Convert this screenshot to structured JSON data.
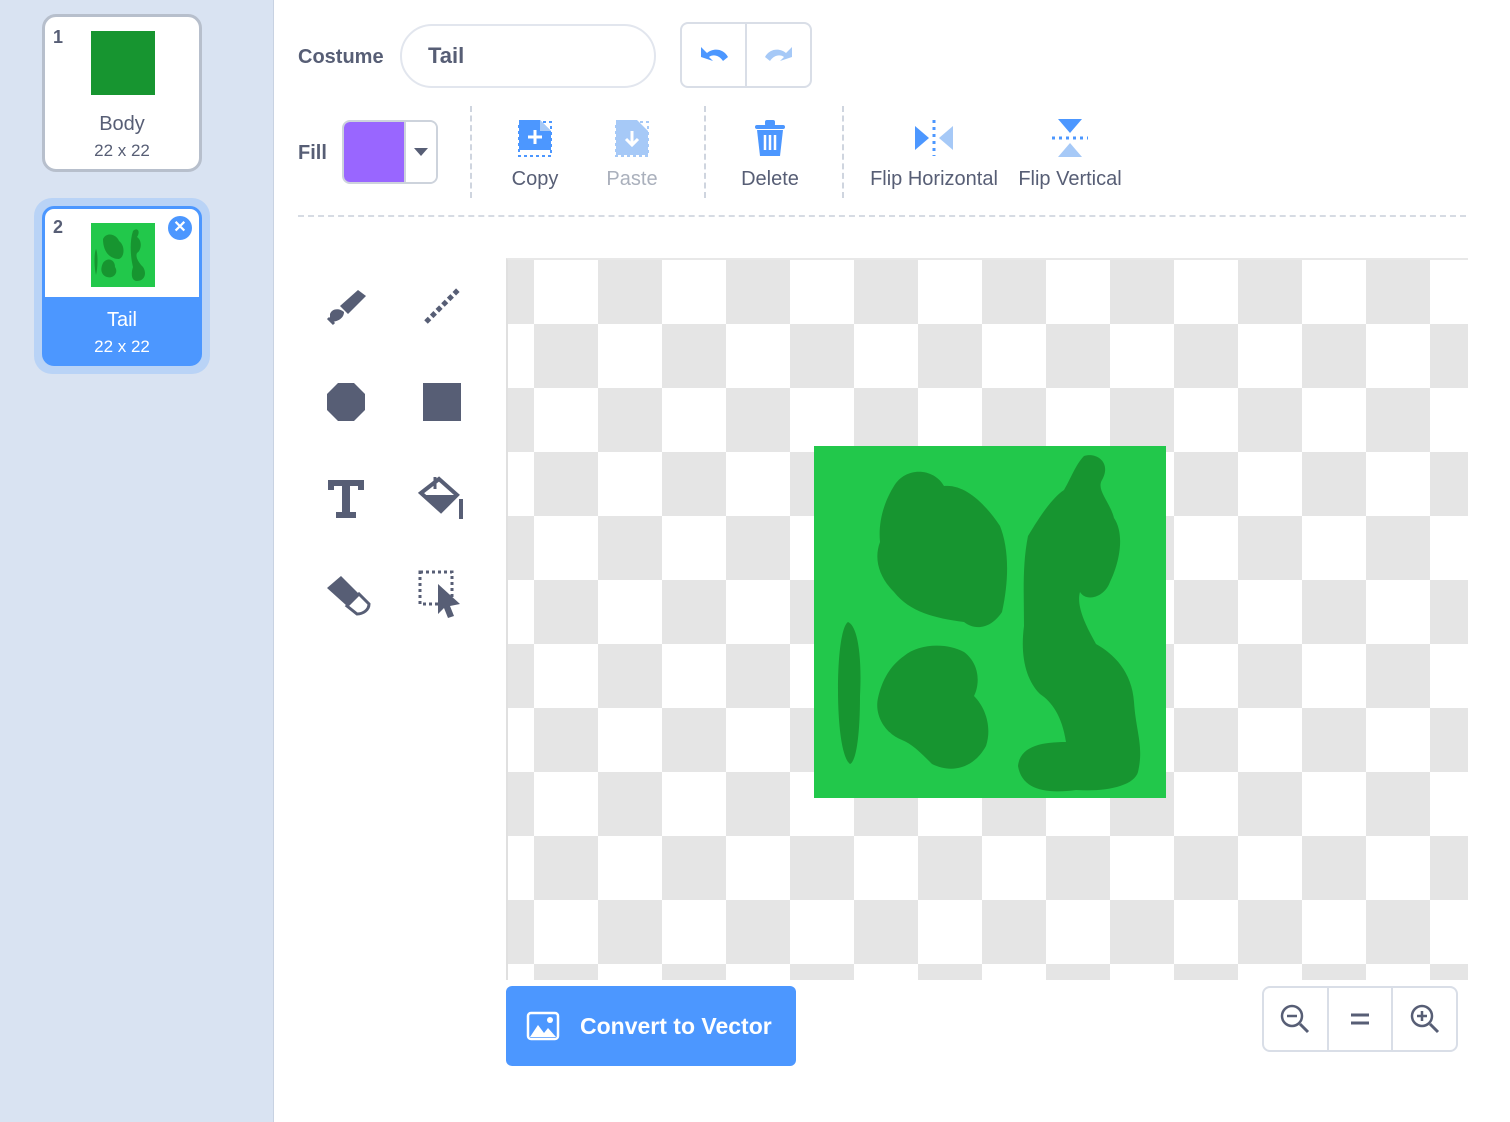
{
  "costumes": [
    {
      "number": "1",
      "name": "Body",
      "size": "22 x 22"
    },
    {
      "number": "2",
      "name": "Tail",
      "size": "22 x 22",
      "selected": true
    }
  ],
  "toolbar": {
    "costume_label": "Costume",
    "costume_name": "Tail",
    "fill_label": "Fill",
    "fill_color": "#9966ff",
    "actions": {
      "copy": "Copy",
      "paste": "Paste",
      "delete": "Delete",
      "flip_horizontal": "Flip Horizontal",
      "flip_vertical": "Flip Vertical"
    }
  },
  "tools": [
    "brush-tool",
    "line-tool",
    "circle-tool",
    "rectangle-tool",
    "text-tool",
    "fill-tool",
    "eraser-tool",
    "select-tool"
  ],
  "convert_button": "Convert to Vector",
  "colors": {
    "accent": "#4c97ff",
    "sprite_light": "#22c84b",
    "sprite_dark": "#179530",
    "text": "#575e75"
  }
}
